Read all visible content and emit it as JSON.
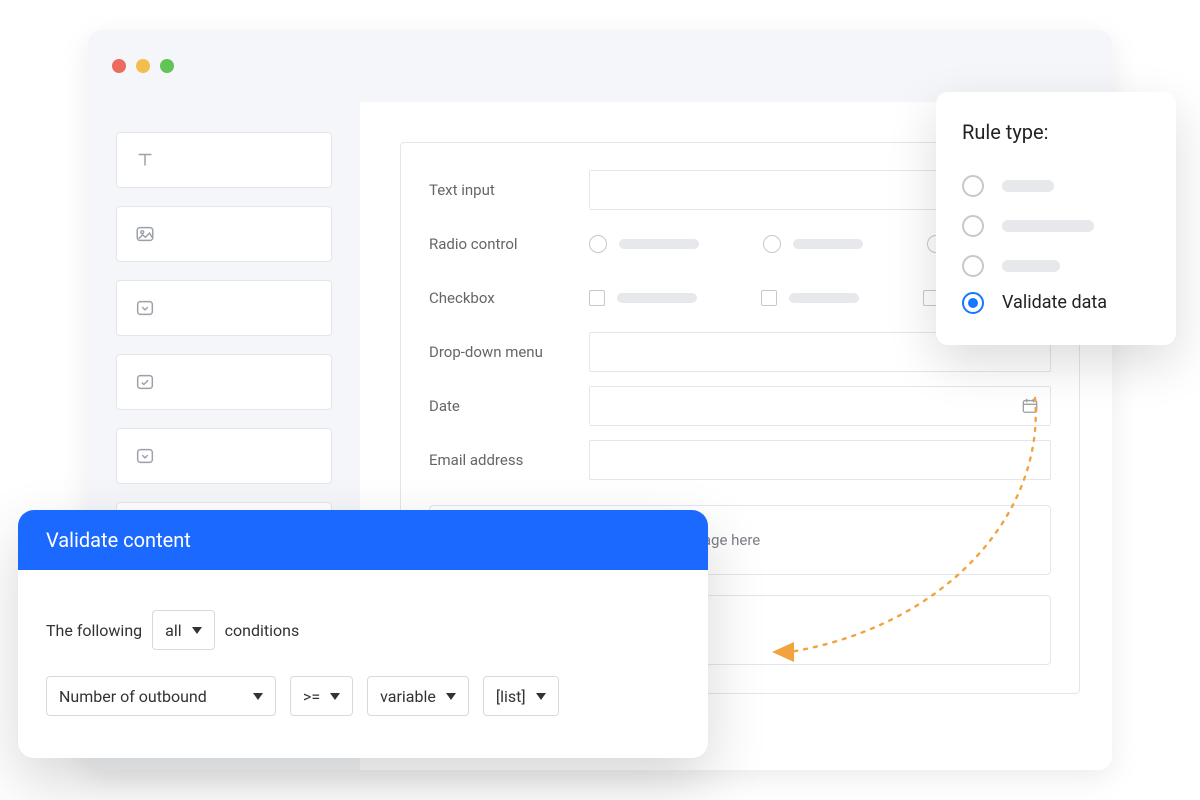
{
  "form": {
    "rows": {
      "text_input": "Text input",
      "radio": "Radio control",
      "checkbox": "Checkbox",
      "dropdown": "Drop-down menu",
      "date": "Date",
      "email": "Email address"
    },
    "dropzone_text": "Drop your image here"
  },
  "rule_popover": {
    "title": "Rule type:",
    "selected_label": "Validate data"
  },
  "validate_card": {
    "title": "Validate content",
    "line_prefix": "The following",
    "line_suffix": "conditions",
    "scope_picker": "all",
    "field_picker": "Number of outbound",
    "operator_picker": ">=",
    "value_type_picker": "variable",
    "value_picker": "[list]"
  },
  "colors": {
    "accent": "#1b69ff",
    "arrow": "#f0a33f"
  }
}
